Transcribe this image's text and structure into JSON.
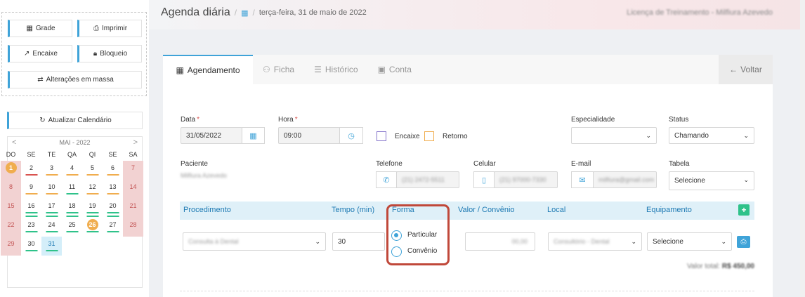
{
  "sidebar": {
    "buttons": {
      "grade": "Grade",
      "imprimir": "Imprimir",
      "encaixe": "Encaixe",
      "bloqueio": "Bloqueio",
      "alteracoes": "Alterações em massa"
    },
    "atualizar": "Atualizar Calendário",
    "calendar": {
      "month": "MAI - 2022",
      "prev": "<",
      "next": ">",
      "dows": [
        "DO",
        "SE",
        "TE",
        "QA",
        "QI",
        "SE",
        "SA"
      ],
      "days": [
        "1",
        "2",
        "3",
        "4",
        "5",
        "6",
        "7",
        "8",
        "9",
        "10",
        "11",
        "12",
        "13",
        "14",
        "15",
        "16",
        "17",
        "18",
        "19",
        "20",
        "21",
        "22",
        "23",
        "24",
        "25",
        "26",
        "27",
        "28",
        "29",
        "30",
        "31"
      ]
    }
  },
  "header": {
    "title": "Agenda diária",
    "separator": "/",
    "date": "terça-feira, 31 de maio de 2022",
    "license": "Licença de Treinamento - Milfiura Azevedo"
  },
  "tabs": {
    "agendamento": "Agendamento",
    "ficha": "Ficha",
    "historico": "Histórico",
    "conta": "Conta",
    "voltar": "Voltar"
  },
  "form": {
    "data_label": "Data",
    "data_value": "31/05/2022",
    "hora_label": "Hora",
    "hora_value": "09:00",
    "required_mark": "*",
    "encaixe": "Encaixe",
    "retorno": "Retorno",
    "especialidade_label": "Especialidade",
    "especialidade_value": "",
    "status_label": "Status",
    "status_value": "Chamando",
    "paciente_label": "Paciente",
    "paciente_value": "Milfiura Azevedo",
    "telefone_label": "Telefone",
    "telefone_value": "(21) 2472-5511",
    "celular_label": "Celular",
    "celular_value": "(21) 97000-7330",
    "email_label": "E-mail",
    "email_value": "milfiura@gmail.com",
    "tabela_label": "Tabela",
    "tabela_value": "Selecione"
  },
  "procedures": {
    "headers": {
      "procedimento": "Procedimento",
      "tempo": "Tempo (min)",
      "forma": "Forma",
      "valor": "Valor / Convênio",
      "local": "Local",
      "equipamento": "Equipamento"
    },
    "plus": "+",
    "row": {
      "procedimento": "Consulta à Dental",
      "tempo": "30",
      "forma_options": [
        "Particular",
        "Convênio"
      ],
      "valor": "00,00",
      "local": "Consultório - Dental",
      "equipamento": "Selecione"
    },
    "total_label": "Valor total:",
    "total_value": "R$ 450,00"
  },
  "colors": {
    "accent": "#3fa3d8",
    "highlight": "#c0483a",
    "green": "#2fc28a",
    "weekend": "#f2d2d2"
  }
}
